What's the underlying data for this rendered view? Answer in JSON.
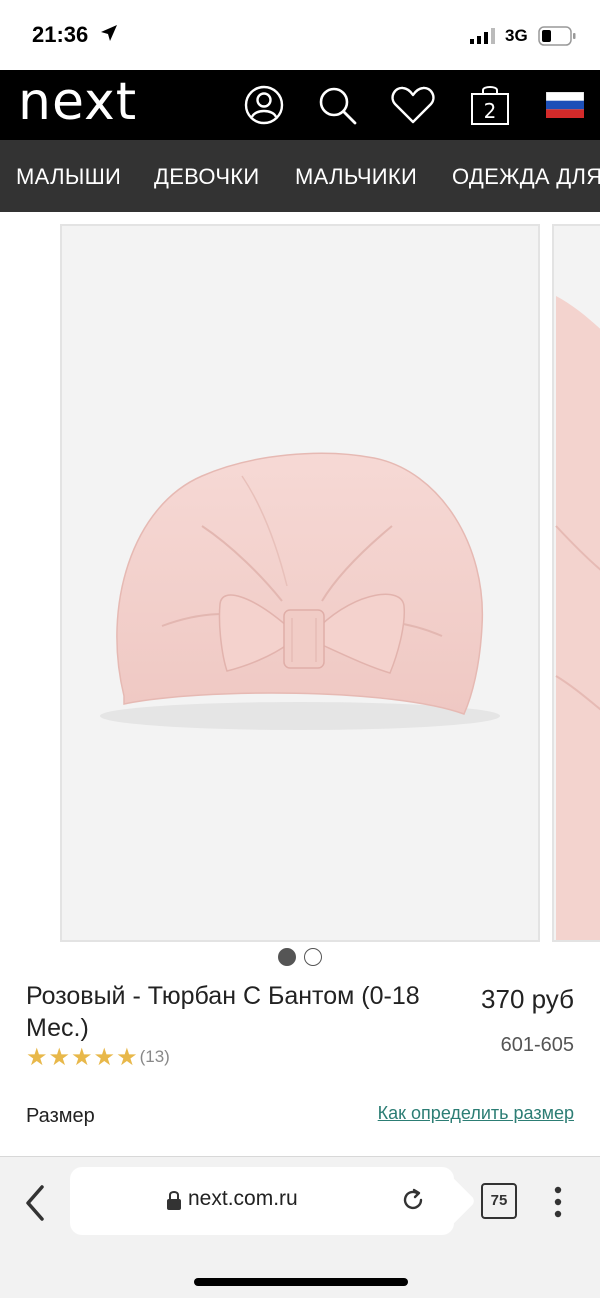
{
  "status": {
    "time": "21:36",
    "network": "3G"
  },
  "header": {
    "logo": "next",
    "bag_count": "2",
    "colors": {
      "background": "#000000",
      "nav": "#333333"
    },
    "icons": [
      "account-icon",
      "search-icon",
      "heart-icon",
      "bag-icon",
      "russia-flag-icon"
    ]
  },
  "nav": {
    "items": [
      {
        "label": "МАЛЫШИ"
      },
      {
        "label": "ДЕВОЧКИ"
      },
      {
        "label": "МАЛЬЧИКИ"
      },
      {
        "label": "ОДЕЖДА ДЛЯ"
      }
    ]
  },
  "gallery": {
    "slide_count": 2,
    "active_slide": 1
  },
  "product": {
    "title": "Розовый - Тюрбан С Бантом (0-18 Мес.)",
    "price": "370 руб",
    "code": "601-605",
    "rating_stars": 5,
    "reviews": "(13)",
    "colors": {
      "star": "#e8b84a",
      "link": "#2c7d74"
    }
  },
  "size": {
    "label": "Размер",
    "guide_link": "Как определить размер"
  },
  "browser": {
    "url": "next.com.ru",
    "tab_count": "75"
  }
}
